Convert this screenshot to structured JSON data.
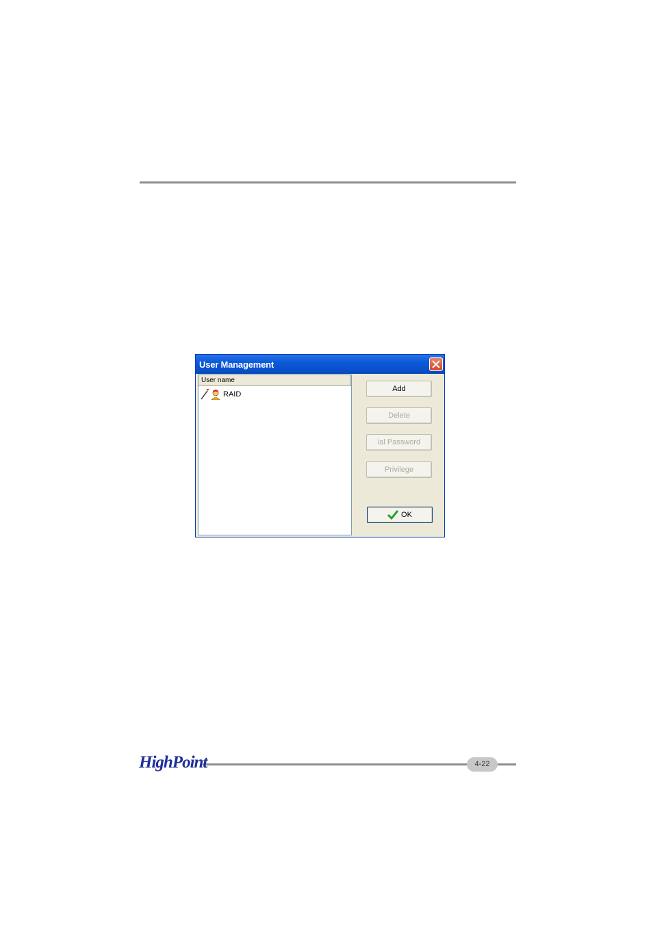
{
  "dialog": {
    "title": "User Management",
    "list": {
      "column_header": "User name",
      "rows": [
        {
          "label": "RAID"
        }
      ]
    },
    "buttons": {
      "add": "Add",
      "delete": "Delete",
      "password": "ial Password",
      "privilege": "Privilege",
      "ok": "OK"
    }
  },
  "footer": {
    "logo": "HighPoint",
    "page_number": "4-22"
  },
  "colors": {
    "titlebar": "#0a5ad8",
    "dialog_bg": "#ece9d8",
    "logo": "#1f2f9a",
    "ok_check": "#2aa02a"
  }
}
